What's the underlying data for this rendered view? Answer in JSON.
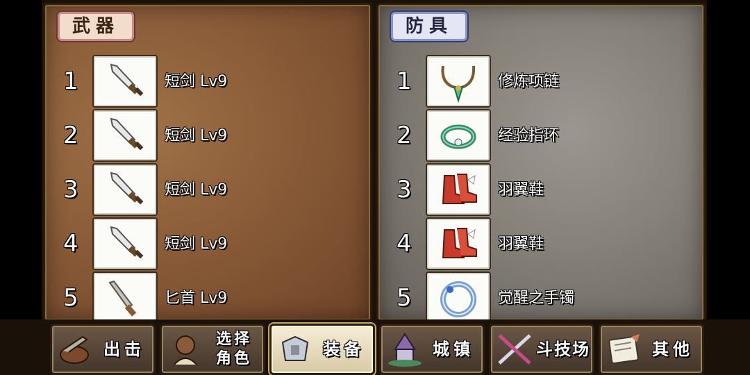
{
  "weapons": {
    "title": "武器",
    "items": [
      {
        "num": "1",
        "label": "短剑 Lv9",
        "icon": "short-sword"
      },
      {
        "num": "2",
        "label": "短剑 Lv9",
        "icon": "short-sword"
      },
      {
        "num": "3",
        "label": "短剑 Lv9",
        "icon": "short-sword"
      },
      {
        "num": "4",
        "label": "短剑 Lv9",
        "icon": "short-sword"
      },
      {
        "num": "5",
        "label": "匕首 Lv9",
        "icon": "dagger"
      }
    ]
  },
  "armor": {
    "title": "防具",
    "items": [
      {
        "num": "1",
        "label": "修炼项链",
        "icon": "necklace"
      },
      {
        "num": "2",
        "label": "经验指环",
        "icon": "ring"
      },
      {
        "num": "3",
        "label": "羽翼鞋",
        "icon": "winged-boots"
      },
      {
        "num": "4",
        "label": "羽翼鞋",
        "icon": "winged-boots"
      },
      {
        "num": "5",
        "label": "觉醒之手镯",
        "icon": "bracelet"
      }
    ]
  },
  "nav": [
    {
      "label": "出击",
      "icon": "sortie-icon"
    },
    {
      "label": "选择角色",
      "icon": "character-select-icon"
    },
    {
      "label": "装备",
      "icon": "equipment-icon",
      "active": true
    },
    {
      "label": "城镇",
      "icon": "town-icon"
    },
    {
      "label": "斗技场",
      "icon": "arena-icon"
    },
    {
      "label": "其他",
      "icon": "other-icon"
    }
  ],
  "colors": {
    "weapons_panel": "#8a5c38",
    "armor_panel": "#858078",
    "active_nav": "#f6eed8"
  }
}
